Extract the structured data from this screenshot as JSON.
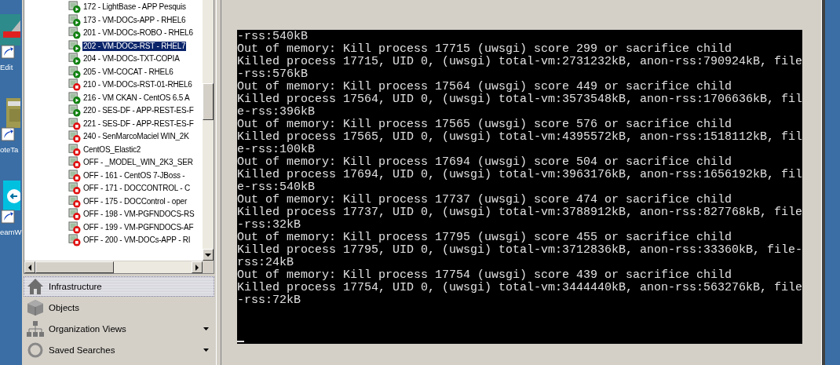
{
  "desktop_icons": [
    {
      "label": "Edit"
    },
    {
      "label": "oteTa"
    },
    {
      "label": "eamW"
    }
  ],
  "tree": {
    "items": [
      {
        "label": "172 - LightBase - APP Pesquis",
        "running": true,
        "selected": false
      },
      {
        "label": "173 - VM-DOCs-APP - RHEL6",
        "running": true,
        "selected": false
      },
      {
        "label": "201 - VM-DOCs-ROBO - RHEL6",
        "running": true,
        "selected": false
      },
      {
        "label": "202 - VM-DOCs-RST - RHEL7",
        "running": true,
        "selected": true
      },
      {
        "label": "204 - VM-DOCs-TXT-COPIA",
        "running": true,
        "selected": false
      },
      {
        "label": "205 - VM-COCAT - RHEL6",
        "running": true,
        "selected": false
      },
      {
        "label": "210 - VM-DOCs-RST-01-RHEL6",
        "running": false,
        "selected": false
      },
      {
        "label": "216 - VM CKAN - CentOS 6.5 A",
        "running": true,
        "selected": false
      },
      {
        "label": "220 - SES-DF - APP-REST-ES-F",
        "running": true,
        "selected": false
      },
      {
        "label": "221 - SES-DF - APP-REST-ES-F",
        "running": false,
        "selected": false
      },
      {
        "label": "240 - SenMarcoMaciel WIN_2K",
        "running": false,
        "selected": false
      },
      {
        "label": "CentOS_Elastic2",
        "running": false,
        "selected": false
      },
      {
        "label": "OFF - _MODEL_WIN_2K3_SER",
        "running": false,
        "selected": false
      },
      {
        "label": "OFF - 161 - CentOS 7-JBoss -",
        "running": false,
        "selected": false
      },
      {
        "label": "OFF - 171 - DOCCONTROL - C",
        "running": false,
        "selected": false
      },
      {
        "label": "OFF - 175 - DOCControl - oper",
        "running": false,
        "selected": false
      },
      {
        "label": "OFF - 198 - VM-PGFNDOCS-RS",
        "running": false,
        "selected": false
      },
      {
        "label": "OFF - 199 - VM-PGFNDOCS-AF",
        "running": false,
        "selected": false
      },
      {
        "label": "OFF - 200 - VM-DOCs-APP - RI",
        "running": false,
        "selected": false
      }
    ]
  },
  "nav": [
    {
      "label": "Infrastructure",
      "kind": "house",
      "selected": true,
      "dropdown": false
    },
    {
      "label": "Objects",
      "kind": "cube",
      "selected": false,
      "dropdown": false
    },
    {
      "label": "Organization Views",
      "kind": "org",
      "selected": false,
      "dropdown": true
    },
    {
      "label": "Saved Searches",
      "kind": "search",
      "selected": false,
      "dropdown": true
    }
  ],
  "console": {
    "lines": [
      "-rss:540kB",
      "Out of memory: Kill process 17715 (uwsgi) score 299 or sacrifice child",
      "Killed process 17715, UID 0, (uwsgi) total-vm:2731232kB, anon-rss:790924kB, file",
      "-rss:576kB",
      "Out of memory: Kill process 17564 (uwsgi) score 449 or sacrifice child",
      "Killed process 17564, UID 0, (uwsgi) total-vm:3573548kB, anon-rss:1706636kB, fil",
      "e-rss:396kB",
      "Out of memory: Kill process 17565 (uwsgi) score 576 or sacrifice child",
      "Killed process 17565, UID 0, (uwsgi) total-vm:4395572kB, anon-rss:1518112kB, fil",
      "e-rss:100kB",
      "Out of memory: Kill process 17694 (uwsgi) score 504 or sacrifice child",
      "Killed process 17694, UID 0, (uwsgi) total-vm:3963176kB, anon-rss:1656192kB, fil",
      "e-rss:540kB",
      "Out of memory: Kill process 17737 (uwsgi) score 474 or sacrifice child",
      "Killed process 17737, UID 0, (uwsgi) total-vm:3788912kB, anon-rss:827768kB, file",
      "-rss:32kB",
      "Out of memory: Kill process 17795 (uwsgi) score 455 or sacrifice child",
      "Killed process 17795, UID 0, (uwsgi) total-vm:3712836kB, anon-rss:33360kB, file-",
      "rss:24kB",
      "Out of memory: Kill process 17754 (uwsgi) score 439 or sacrifice child",
      "Killed process 17754, UID 0, (uwsgi) total-vm:3444440kB, anon-rss:563276kB, file",
      "-rss:72kB"
    ]
  }
}
